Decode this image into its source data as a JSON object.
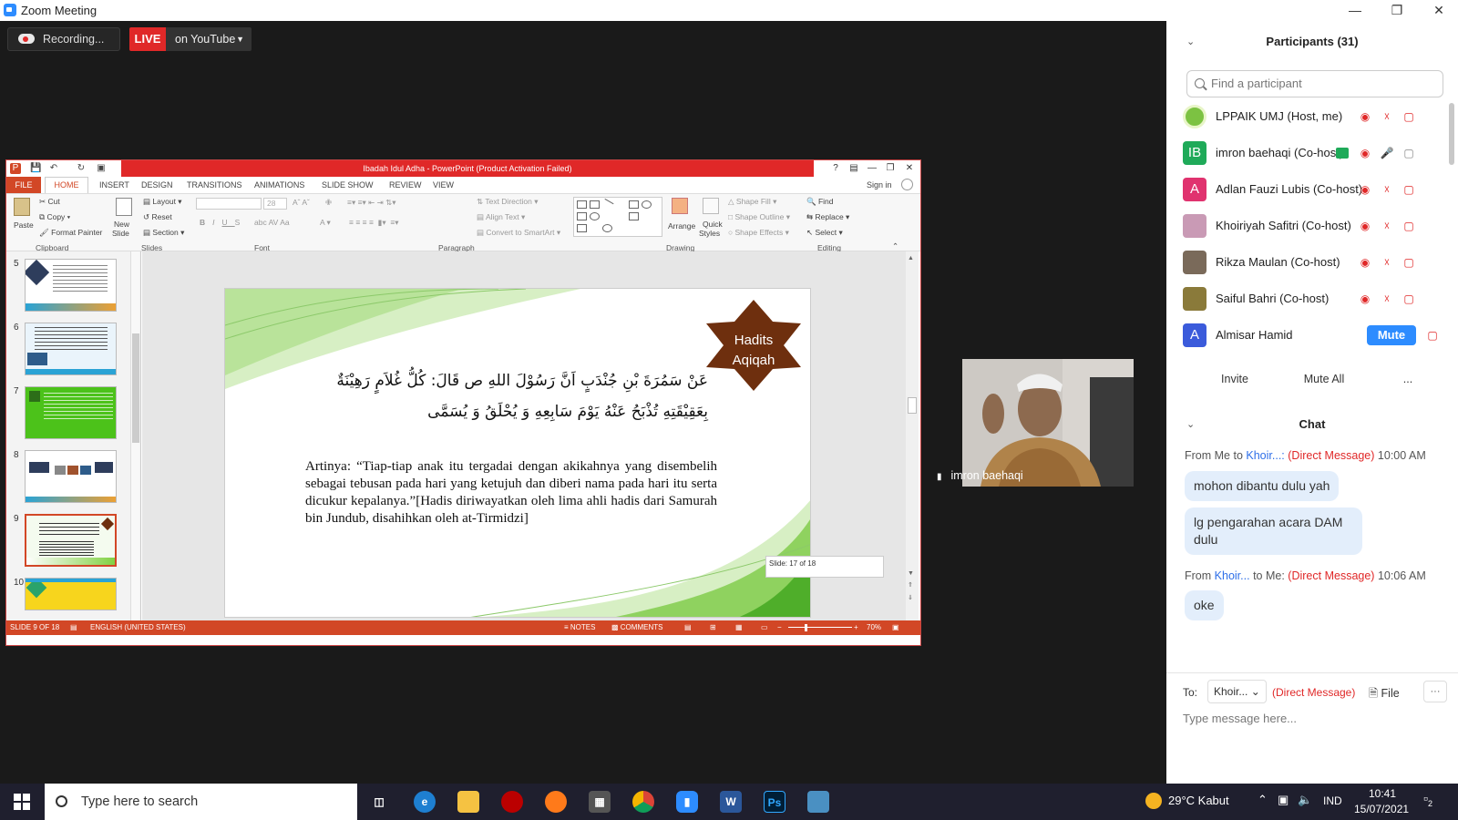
{
  "window": {
    "title": "Zoom Meeting"
  },
  "toolbar": {
    "recording": "Recording...",
    "live": "LIVE",
    "youtube": "on YouTube"
  },
  "ppt": {
    "title": "Ibadah Idul Adha  -  PowerPoint (Product Activation Failed)",
    "tabs": [
      "FILE",
      "HOME",
      "INSERT",
      "DESIGN",
      "TRANSITIONS",
      "ANIMATIONS",
      "SLIDE SHOW",
      "REVIEW",
      "VIEW"
    ],
    "signin": "Sign in",
    "ribbon": {
      "paste": "Paste",
      "cut": "Cut",
      "copy": "Copy",
      "format_painter": "Format Painter",
      "new_slide": "New",
      "new_slide2": "Slide",
      "layout": "Layout",
      "reset": "Reset",
      "section": "Section",
      "font_size": "28",
      "text_direction": "Text Direction",
      "align_text": "Align Text",
      "convert_smartart": "Convert to SmartArt",
      "arrange": "Arrange",
      "quick_styles": "Quick",
      "quick_styles2": "Styles",
      "shape_fill": "Shape Fill",
      "shape_outline": "Shape Outline",
      "shape_effects": "Shape Effects",
      "find": "Find",
      "replace": "Replace",
      "select": "Select",
      "groups": {
        "clipboard": "Clipboard",
        "slides": "Slides",
        "font": "Font",
        "paragraph": "Paragraph",
        "drawing": "Drawing",
        "editing": "Editing"
      }
    },
    "thumbs": [
      "5",
      "6",
      "7",
      "8",
      "9",
      "10"
    ],
    "slide": {
      "badge_line1": "Hadits",
      "badge_line2": "Aqiqah",
      "arabic_line1": "عَنْ سَمُرَةَ بْنِ جُنْدَبٍ اَنَّ رَسُوْلَ اللهِ ص قَالَ: كُلُّ غُلاَمٍ رَهِيْنَةٌ",
      "arabic_line2": "بِعَقِيْقَتِهِ تُذْبَحُ عَنْهُ يَوْمَ سَابِعِهِ وَ يُحْلَقُ وَ يُسَمَّى",
      "translation": "Artinya: “Tiap-tiap anak itu tergadai dengan akikahnya yang disembelih sebagai tebusan pada hari yang ketujuh dan diberi nama pada hari itu serta dicukur kepalanya.”[Hadis diriwayatkan oleh lima ahli hadis dari Samurah bin Jundub, disahihkan oleh at-Tirmidzi]",
      "tooltip": "Slide: 17 of 18"
    },
    "status": {
      "slide": "SLIDE 9 OF 18",
      "language": "ENGLISH (UNITED STATES)",
      "notes": "NOTES",
      "comments": "COMMENTS",
      "zoom": "70%"
    }
  },
  "video": {
    "name": "imron baehaqi"
  },
  "participants": {
    "header": "Participants (31)",
    "search_placeholder": "Find a participant",
    "list": [
      {
        "name": "LPPAIK UMJ (Host, me)",
        "initials": "",
        "color": "#7cc242"
      },
      {
        "name": "imron baehaqi (Co-host)",
        "initials": "IB",
        "color": "#1faa59"
      },
      {
        "name": "Adlan Fauzi Lubis (Co-host)",
        "initials": "A",
        "color": "#e0336f"
      },
      {
        "name": "Khoiriyah Safitri (Co-host)",
        "initials": "",
        "color": "#c99ab5"
      },
      {
        "name": "Rikza Maulan (Co-host)",
        "initials": "",
        "color": "#7a6a5a"
      },
      {
        "name": "Saiful Bahri (Co-host)",
        "initials": "",
        "color": "#8a7a3a"
      },
      {
        "name": "Almisar Hamid",
        "initials": "A",
        "color": "#3b5bdb"
      }
    ],
    "mute_label": "Mute",
    "invite": "Invite",
    "mute_all": "Mute All",
    "more": "..."
  },
  "chat": {
    "header": "Chat",
    "messages": [
      {
        "from": "From Me to",
        "to": "Khoir...:",
        "dm": "(Direct Message)",
        "time": "10:00 AM",
        "lines": [
          "mohon dibantu dulu yah",
          "lg pengarahan acara DAM dulu"
        ]
      },
      {
        "from": "From",
        "to": "Khoir...",
        "to2": "to Me:",
        "dm": "(Direct Message)",
        "time": "10:06 AM",
        "lines": [
          "oke"
        ]
      }
    ],
    "to_label": "To:",
    "to_value": "Khoir...",
    "to_dm": "(Direct Message)",
    "file": "File",
    "more": "···",
    "placeholder": "Type message here..."
  },
  "taskbar": {
    "search": "Type here to search",
    "weather": "29°C  Kabut",
    "lang": "IND",
    "time": "10:41",
    "date": "15/07/2021",
    "notif": "2"
  }
}
